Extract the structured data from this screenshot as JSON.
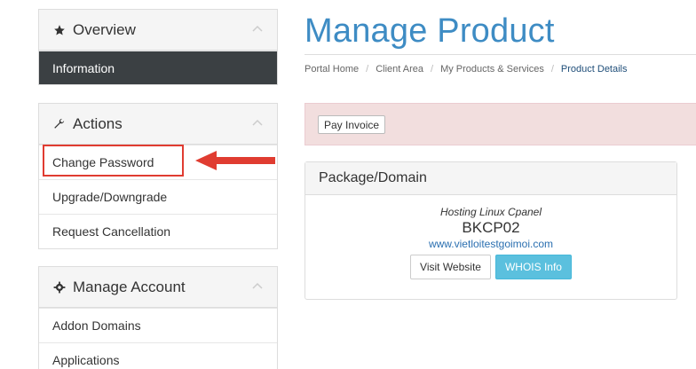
{
  "sidebar": {
    "overview": {
      "title": "Overview",
      "icon": "star-icon",
      "items": [
        {
          "label": "Information",
          "active": true
        }
      ]
    },
    "actions": {
      "title": "Actions",
      "icon": "wrench-icon",
      "items": [
        {
          "label": "Change Password"
        },
        {
          "label": "Upgrade/Downgrade"
        },
        {
          "label": "Request Cancellation"
        }
      ]
    },
    "account": {
      "title": "Manage Account",
      "icon": "gear-icon",
      "items": [
        {
          "label": "Addon Domains"
        },
        {
          "label": "Applications"
        }
      ]
    }
  },
  "main": {
    "title": "Manage Product",
    "breadcrumb": [
      "Portal Home",
      "Client Area",
      "My Products & Services",
      "Product Details"
    ],
    "alert": {
      "pay_button": "Pay Invoice"
    },
    "package": {
      "heading": "Package/Domain",
      "type": "Hosting Linux Cpanel",
      "name": "BKCP02",
      "domain": "www.vietloitestgoimoi.com",
      "visit_button": "Visit Website",
      "whois_button": "WHOIS Info"
    }
  },
  "colors": {
    "title_blue": "#3e8cc4",
    "active_item_bg": "#3b4043",
    "alert_bg": "#f2dede",
    "info_button": "#5bc0de",
    "annotation_red": "#e03c31"
  }
}
